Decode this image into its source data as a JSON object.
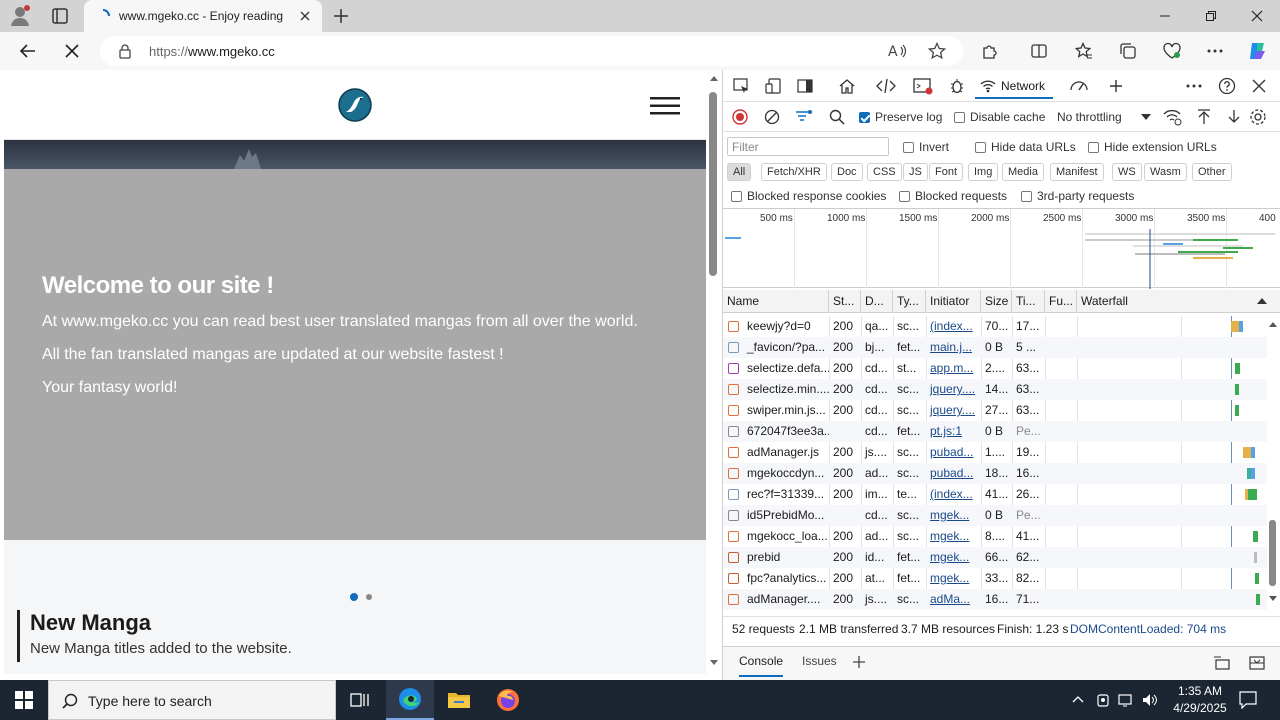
{
  "browser": {
    "tab_title": "www.mgeko.cc - Enjoy reading",
    "url_prefix": "https://",
    "url_host": "www.mgeko.cc"
  },
  "page": {
    "hero_title": "Welcome to our site !",
    "hero_lines": [
      "At www.mgeko.cc you can read best user translated mangas from all over the world.",
      "All the fan translated mangas are updated at our website fastest !",
      "Your fantasy world!"
    ],
    "section_title": "New Manga",
    "section_subtitle": "New Manga titles added to the website."
  },
  "devtools": {
    "active_tab": "Network",
    "preserve_log": "Preserve log",
    "disable_cache": "Disable cache",
    "throttling": "No throttling",
    "filter_placeholder": "Filter",
    "invert": "Invert",
    "hide_data_urls": "Hide data URLs",
    "hide_extension_urls": "Hide extension URLs",
    "types": [
      "All",
      "Fetch/XHR",
      "Doc",
      "CSS",
      "JS",
      "Font",
      "Img",
      "Media",
      "Manifest",
      "WS",
      "Wasm",
      "Other"
    ],
    "blocked_response_cookies": "Blocked response cookies",
    "blocked_requests": "Blocked requests",
    "third_party_requests": "3rd-party requests",
    "ticks": [
      "500 ms",
      "1000 ms",
      "1500 ms",
      "2000 ms",
      "2500 ms",
      "3000 ms",
      "3500 ms",
      "400"
    ],
    "columns": [
      "Name",
      "St...",
      "D...",
      "Ty...",
      "Initiator",
      "Size",
      "Ti...",
      "Fu...",
      "Waterfall"
    ],
    "rows": [
      {
        "name": "keewjy?d=0",
        "status": "200",
        "domain": "qa...",
        "type": "sc...",
        "initiator": "(index...",
        "size": "70...",
        "time": "17..."
      },
      {
        "name": "_favicon/?pa...",
        "status": "200",
        "domain": "bj...",
        "type": "fet...",
        "initiator": "main.j...",
        "size": "0 B",
        "time": "5 ..."
      },
      {
        "name": "selectize.defa...",
        "status": "200",
        "domain": "cd...",
        "type": "st...",
        "initiator": "app.m...",
        "size": "2....",
        "time": "63..."
      },
      {
        "name": "selectize.min....",
        "status": "200",
        "domain": "cd...",
        "type": "sc...",
        "initiator": "jquery....",
        "size": "14...",
        "time": "63..."
      },
      {
        "name": "swiper.min.js...",
        "status": "200",
        "domain": "cd...",
        "type": "sc...",
        "initiator": "jquery....",
        "size": "27...",
        "time": "63..."
      },
      {
        "name": "672047f3ee3a...",
        "status": "",
        "domain": "cd...",
        "type": "fet...",
        "initiator": "pt.js:1",
        "size": "0 B",
        "time": "Pe..."
      },
      {
        "name": "adManager.js",
        "status": "200",
        "domain": "js....",
        "type": "sc...",
        "initiator": "pubad...",
        "size": "1....",
        "time": "19..."
      },
      {
        "name": "mgekoccdyn...",
        "status": "200",
        "domain": "ad...",
        "type": "sc...",
        "initiator": "pubad...",
        "size": "18...",
        "time": "16..."
      },
      {
        "name": "rec?f=31339...",
        "status": "200",
        "domain": "im...",
        "type": "te...",
        "initiator": "(index...",
        "size": "41...",
        "time": "26..."
      },
      {
        "name": "id5PrebidMo...",
        "status": "",
        "domain": "cd...",
        "type": "sc...",
        "initiator": "mgek...",
        "size": "0 B",
        "time": "Pe..."
      },
      {
        "name": "mgekocc_loa...",
        "status": "200",
        "domain": "ad...",
        "type": "sc...",
        "initiator": "mgek...",
        "size": "8....",
        "time": "41..."
      },
      {
        "name": "prebid",
        "status": "200",
        "domain": "id...",
        "type": "fet...",
        "initiator": "mgek...",
        "size": "66...",
        "time": "62..."
      },
      {
        "name": "fpc?analytics...",
        "status": "200",
        "domain": "at...",
        "type": "fet...",
        "initiator": "mgek...",
        "size": "33...",
        "time": "82..."
      },
      {
        "name": "adManager....",
        "status": "200",
        "domain": "js....",
        "type": "sc...",
        "initiator": "adMa...",
        "size": "16...",
        "time": "71..."
      }
    ],
    "status_bar": {
      "requests": "52 requests",
      "transferred": "2.1 MB transferred",
      "resources": "3.7 MB resources",
      "finish": "Finish: 1.23 s",
      "dcl": "DOMContentLoaded: 704 ms"
    },
    "drawer_tabs": [
      "Console",
      "Issues"
    ]
  },
  "taskbar": {
    "search_placeholder": "Type here to search",
    "time": "1:35 AM",
    "date": "4/29/2025"
  },
  "colors": {
    "accent": "#0f6cbd",
    "hero_bg": "#a9a9a9",
    "taskbar": "#1c2633"
  }
}
